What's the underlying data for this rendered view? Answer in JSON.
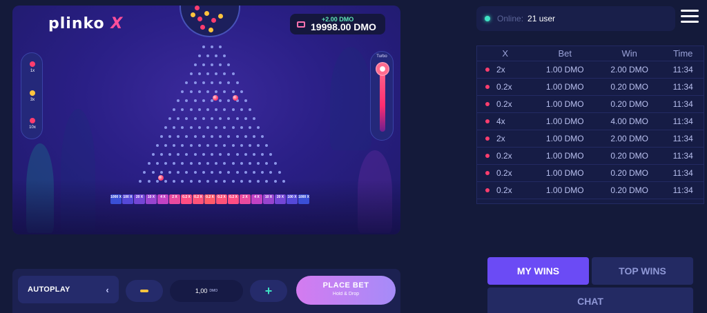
{
  "game": {
    "logo_text": "plinko",
    "logo_x": "X",
    "balance_delta": "+2.00 DMO",
    "balance_amount": "19998.00 DMO",
    "risk_levels": [
      "1x",
      "3x",
      "10x"
    ],
    "turbo_label": "Turbo",
    "multipliers": [
      "1000 X",
      "100 X",
      "20 X",
      "10 X",
      "4 X",
      "2 X",
      "0.2 X",
      "0.2 X",
      "0.2 X",
      "0.2 X",
      "0.2 X",
      "2 X",
      "4 X",
      "10 X",
      "20 X",
      "100 X",
      "1000 X"
    ],
    "bucket_colors": [
      "#3a4fd6",
      "#5548d8",
      "#7446d6",
      "#9844cf",
      "#c242c4",
      "#e94a9e",
      "#ff4d83",
      "#ff5279",
      "#ff5a6a",
      "#ff5279",
      "#ff4d83",
      "#e94a9e",
      "#c242c4",
      "#9844cf",
      "#7446d6",
      "#5548d8",
      "#3a4fd6"
    ],
    "peg_rows": 16
  },
  "controls": {
    "autoplay_label": "AUTOPLAY",
    "stake_value": "1,00",
    "stake_unit": "DMO",
    "plus_symbol": "+",
    "place_bet_label": "PLACE BET",
    "place_bet_sub": "Hold & Drop"
  },
  "online": {
    "label": "Online:",
    "value": "21 user"
  },
  "table": {
    "headers": [
      "X",
      "Bet",
      "Win",
      "Time"
    ],
    "rows": [
      {
        "x": "2x",
        "bet": "1.00 DMO",
        "win": "2.00 DMO",
        "time": "11:34"
      },
      {
        "x": "0.2x",
        "bet": "1.00 DMO",
        "win": "0.20 DMO",
        "time": "11:34"
      },
      {
        "x": "0.2x",
        "bet": "1.00 DMO",
        "win": "0.20 DMO",
        "time": "11:34"
      },
      {
        "x": "4x",
        "bet": "1.00 DMO",
        "win": "4.00 DMO",
        "time": "11:34"
      },
      {
        "x": "2x",
        "bet": "1.00 DMO",
        "win": "2.00 DMO",
        "time": "11:34"
      },
      {
        "x": "0.2x",
        "bet": "1.00 DMO",
        "win": "0.20 DMO",
        "time": "11:34"
      },
      {
        "x": "0.2x",
        "bet": "1.00 DMO",
        "win": "0.20 DMO",
        "time": "11:34"
      },
      {
        "x": "0.2x",
        "bet": "1.00 DMO",
        "win": "0.20 DMO",
        "time": "11:34"
      }
    ]
  },
  "tabs": {
    "my_wins": "MY WINS",
    "top_wins": "TOP WINS",
    "chat": "CHAT"
  },
  "colors": {
    "accent": "#6b4bf5",
    "online": "#3fe2c4",
    "ball": "#ff3d6e"
  }
}
